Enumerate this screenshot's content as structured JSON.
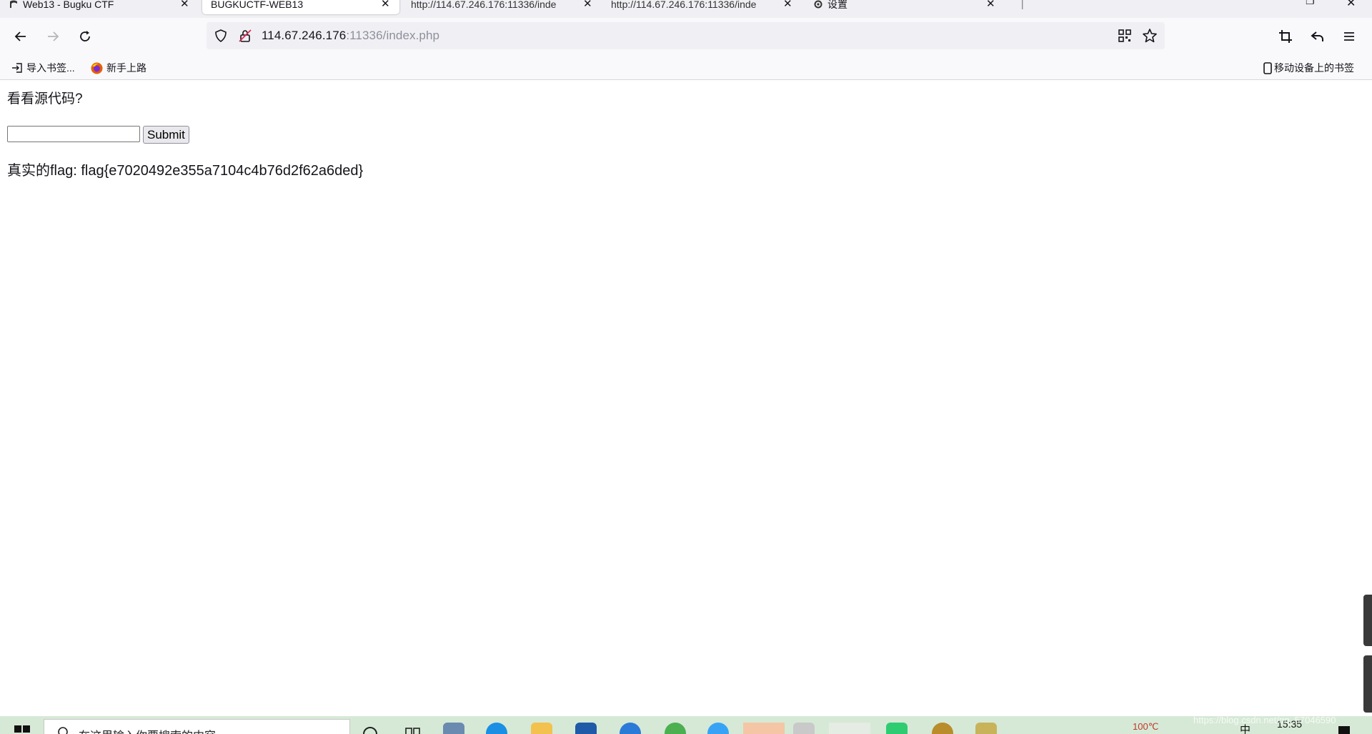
{
  "browser": {
    "tabs": [
      {
        "title": "Web13 - Bugku CTF",
        "active": false
      },
      {
        "title": "BUGKUCTF-WEB13",
        "active": true
      },
      {
        "title": "http://114.67.246.176:11336/inde",
        "active": false
      },
      {
        "title": "http://114.67.246.176:11336/inde",
        "active": false
      },
      {
        "title": "设置",
        "active": false
      }
    ],
    "address": {
      "host": "114.67.246.176",
      "port_and_path": ":11336/index.php"
    },
    "bookmarks": [
      {
        "label": "导入书签...",
        "icon": "import-icon"
      },
      {
        "label": "新手上路",
        "icon": "firefox-icon"
      }
    ],
    "mobile_bookmarks_label": "移动设备上的书签"
  },
  "page": {
    "hint": "看看源代码?",
    "input_value": "",
    "submit_label": "Submit",
    "flag_text": "真实的flag: flag{e7020492e355a7104c4b76d2f62a6ded}"
  },
  "taskbar": {
    "search_placeholder": "在这里输入你要搜索的内容",
    "temperature": "100℃",
    "ime": "中",
    "time": "15:35"
  },
  "watermark": "https://blog.csdn.net/qq_57046590",
  "colors": {
    "accent_firefox": "#e66000",
    "taskbar_bg": "#d6e9d6",
    "url_dim": "#8f8f9d"
  }
}
